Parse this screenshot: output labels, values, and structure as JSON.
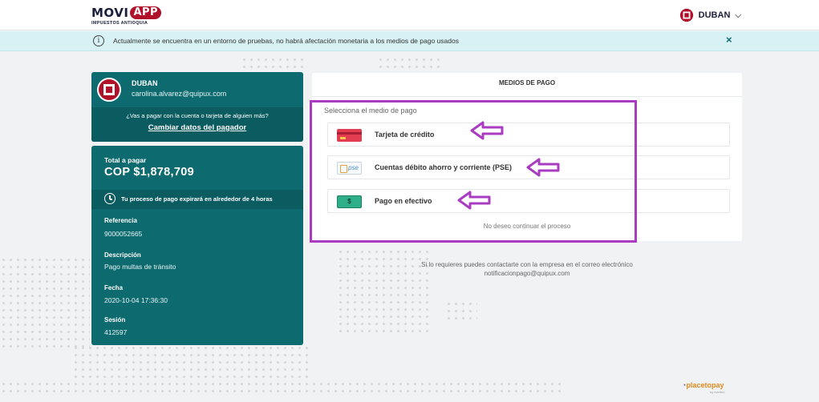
{
  "header": {
    "logo_text": "MOVI",
    "logo_badge": "APP",
    "logo_subtitle": "IMPUESTOS ANTIOQUIA",
    "user_name": "DUBAN",
    "user_chevron": "⌵"
  },
  "notice": {
    "icon": "i",
    "text": "Actualmente se encuentra en un entorno de pruebas, no habrá afectación monetaria a los medios de pago usados",
    "close": "×"
  },
  "payer": {
    "name": "DUBAN",
    "email": "carolina.alvarez@quipux.com",
    "question": "¿Vas a pagar con la cuenta o tarjeta de alguien más?",
    "change_link": "Cambiar datos del pagador"
  },
  "summary": {
    "total_label": "Total a pagar",
    "total_amount": "COP $1,878,709",
    "expire_text": "Tu proceso de pago expirará en alrededor de 4 horas",
    "reference_label": "Referencia",
    "reference_value": "9000052665",
    "description_label": "Descripción",
    "description_value": "Pago multas de tránsito",
    "date_label": "Fecha",
    "date_value": "2020-10-04 17:36:30",
    "session_label": "Sesión",
    "session_value": "412597"
  },
  "methods": {
    "title": "MEDIOS DE PAGO",
    "select_label": "Selecciona el medio de pago",
    "items": [
      {
        "label": "Tarjeta de crédito",
        "icon": "credit-card-icon"
      },
      {
        "label": "Cuentas débito ahorro y corriente (PSE)",
        "icon": "pse-icon",
        "icon_text": "pse"
      },
      {
        "label": "Pago en efectivo",
        "icon": "cash-icon",
        "icon_text": "$"
      }
    ],
    "cancel": "No deseo continuar el proceso"
  },
  "contact": {
    "line1": "Si lo requieres puedes contactarte con la empresa en el correo electrónico",
    "line2": "notificacionpago@quipux.com"
  },
  "provider": {
    "brand": "placetopay",
    "sub": "by evertec"
  },
  "colors": {
    "primary": "#0d6b70",
    "highlight": "#a93cc0",
    "notice_bg": "#d7f1f5"
  }
}
